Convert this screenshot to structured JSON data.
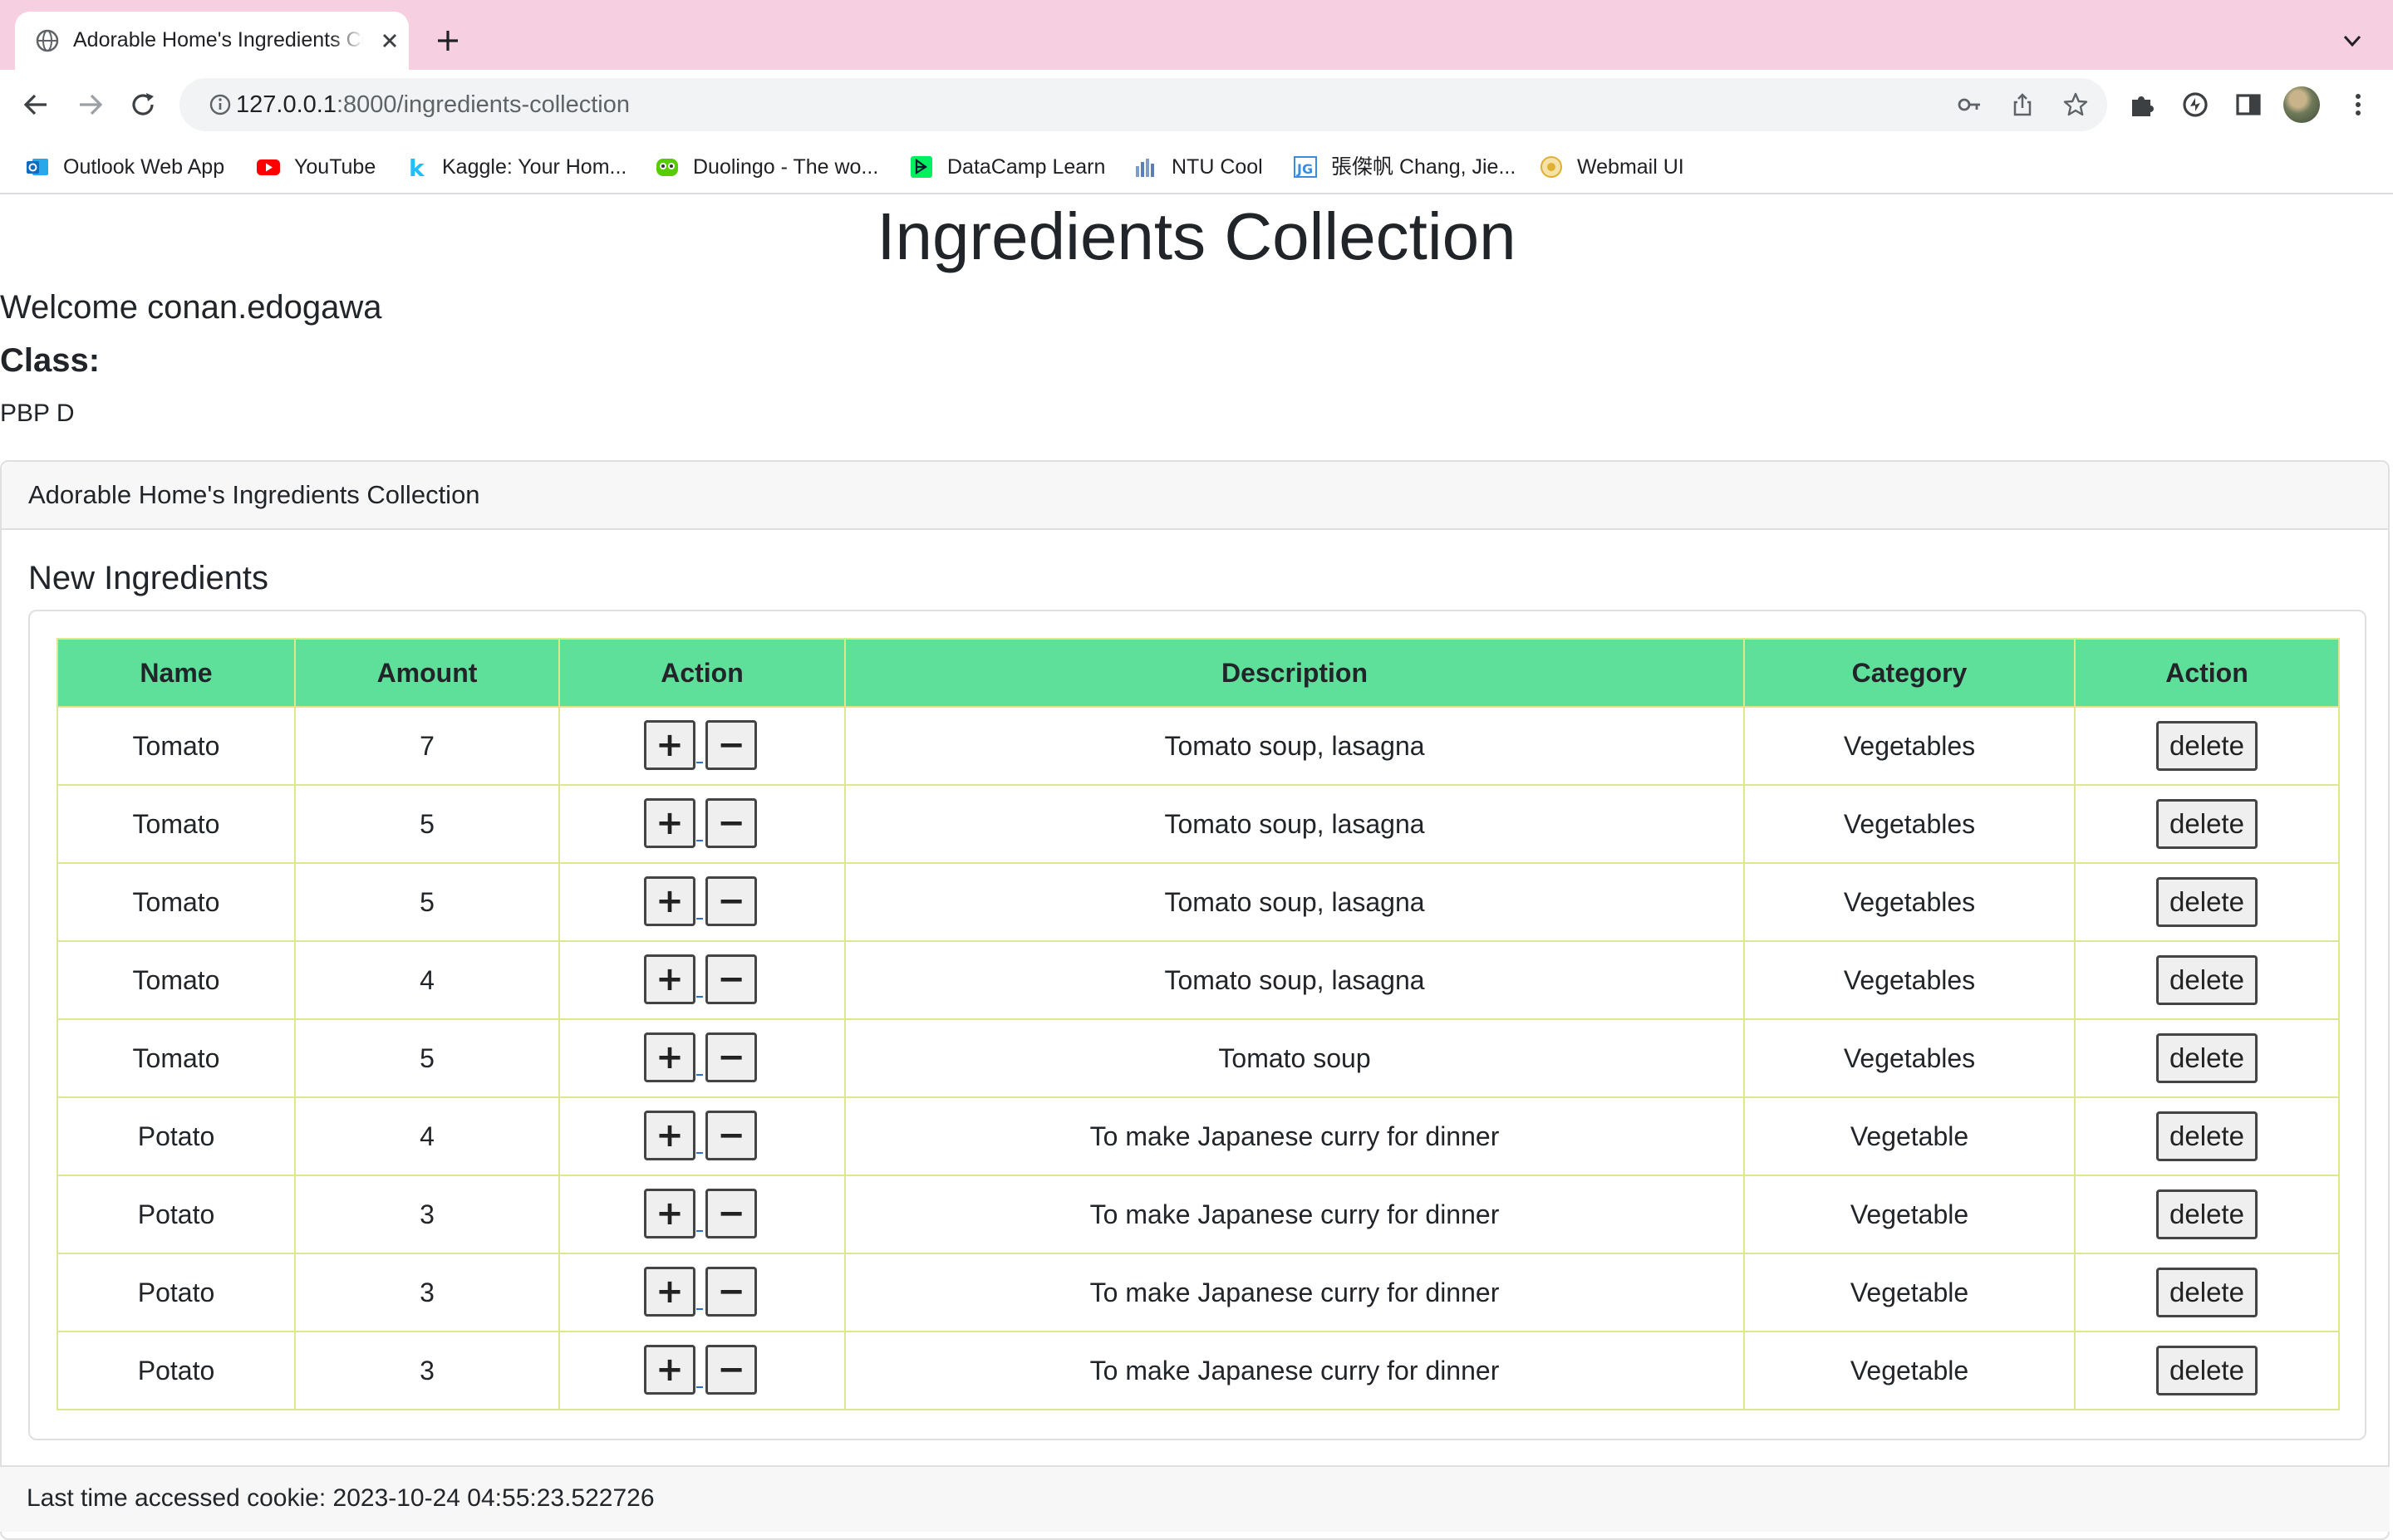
{
  "browser": {
    "tab_title": "Adorable Home's Ingredients Collection",
    "url_host": "127.0.0.1",
    "url_rest": ":8000/ingredients-collection",
    "bookmarks": [
      {
        "label": "Outlook Web App",
        "icon": "outlook-icon",
        "color": "#0f6cbd"
      },
      {
        "label": "YouTube",
        "icon": "youtube-icon",
        "color": "#ff0000"
      },
      {
        "label": "Kaggle: Your Hom...",
        "icon": "kaggle-icon",
        "color": "#20beff"
      },
      {
        "label": "Duolingo - The wo...",
        "icon": "duolingo-icon",
        "color": "#58cc02"
      },
      {
        "label": "DataCamp Learn",
        "icon": "datacamp-icon",
        "color": "#03ef62"
      },
      {
        "label": "NTU Cool",
        "icon": "ntu-cool-icon",
        "color": "#5a7fb8"
      },
      {
        "label": "張傑帆 Chang, Jie...",
        "icon": "jg-icon",
        "color": "#3a8dde"
      },
      {
        "label": "Webmail UI",
        "icon": "webmail-icon",
        "color": "#e0b030"
      }
    ]
  },
  "page": {
    "title": "Ingredients Collection",
    "welcome": "Welcome conan.edogawa",
    "class_label": "Class:",
    "class_value": "PBP D",
    "card_header": "Adorable Home's Ingredients Collection",
    "section_title": "New Ingredients",
    "footer_text": "Last time accessed cookie: 2023-10-24 04:55:23.522726"
  },
  "table": {
    "headers": [
      "Name",
      "Amount",
      "Action",
      "Description",
      "Category",
      "Action"
    ],
    "plus_label": "+",
    "minus_label": "−",
    "delete_label": "delete",
    "rows": [
      {
        "name": "Tomato",
        "amount": "7",
        "description": "Tomato soup, lasagna",
        "category": "Vegetables"
      },
      {
        "name": "Tomato",
        "amount": "5",
        "description": "Tomato soup, lasagna",
        "category": "Vegetables"
      },
      {
        "name": "Tomato",
        "amount": "5",
        "description": "Tomato soup, lasagna",
        "category": "Vegetables"
      },
      {
        "name": "Tomato",
        "amount": "4",
        "description": "Tomato soup, lasagna",
        "category": "Vegetables"
      },
      {
        "name": "Tomato",
        "amount": "5",
        "description": "Tomato soup",
        "category": "Vegetables"
      },
      {
        "name": "Potato",
        "amount": "4",
        "description": "To make Japanese curry for dinner",
        "category": "Vegetable"
      },
      {
        "name": "Potato",
        "amount": "3",
        "description": "To make Japanese curry for dinner",
        "category": "Vegetable"
      },
      {
        "name": "Potato",
        "amount": "3",
        "description": "To make Japanese curry for dinner",
        "category": "Vegetable"
      },
      {
        "name": "Potato",
        "amount": "3",
        "description": "To make Japanese curry for dinner",
        "category": "Vegetable"
      }
    ]
  },
  "colors": {
    "tabstrip": "#f6cfe0",
    "table_header": "#5ee09a",
    "table_border": "#dde88e"
  }
}
